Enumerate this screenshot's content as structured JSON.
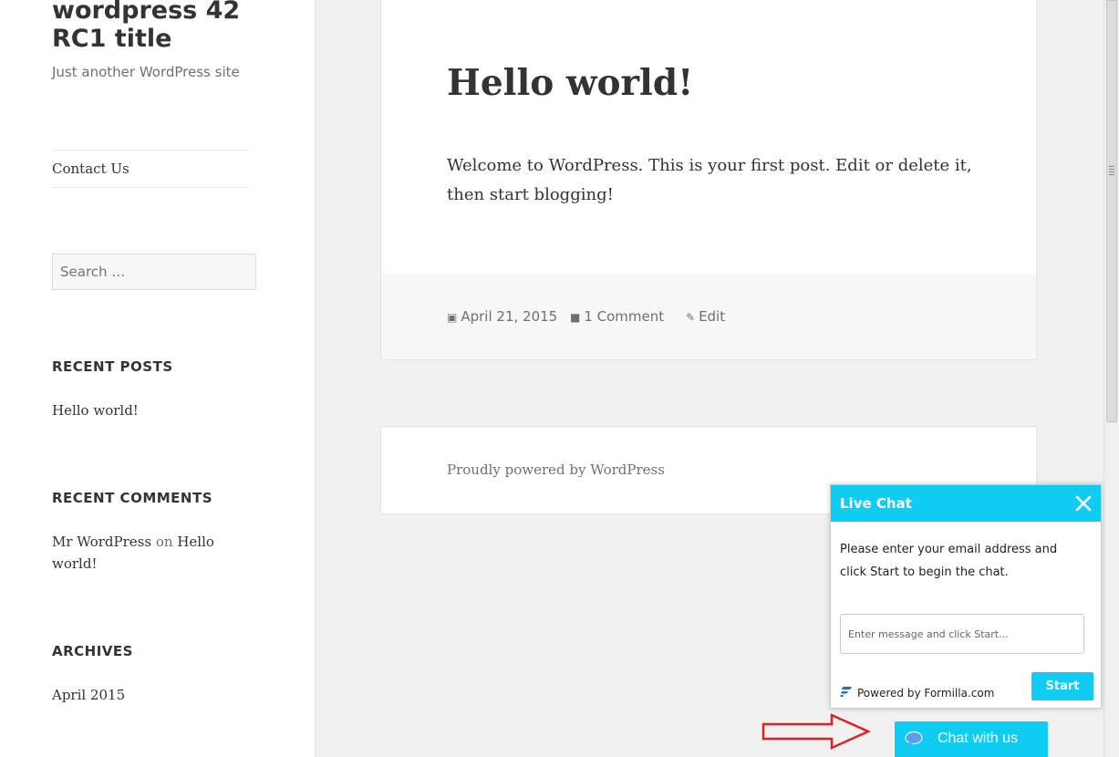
{
  "site": {
    "title": "wordpress 42 RC1 title",
    "description": "Just another WordPress site"
  },
  "menu": {
    "items": [
      {
        "label": "Contact Us"
      }
    ]
  },
  "search": {
    "placeholder": "Search …"
  },
  "widgets": {
    "recent_posts": {
      "title": "RECENT POSTS",
      "items": [
        "Hello world!"
      ]
    },
    "recent_comments": {
      "title": "RECENT COMMENTS",
      "author": "Mr WordPress",
      "connector": "on",
      "post": "Hello world!"
    },
    "archives": {
      "title": "ARCHIVES",
      "items": [
        "April 2015"
      ]
    }
  },
  "post": {
    "title": "Hello world!",
    "body": "Welcome to WordPress. This is your first post. Edit or delete it, then start blogging!",
    "date": "April 21, 2015",
    "comments": "1 Comment",
    "edit": "Edit"
  },
  "footer": {
    "text": "Proudly powered by WordPress"
  },
  "live_chat": {
    "title": "Live Chat",
    "message": "Please enter your email address and click Start to begin the chat.",
    "input_placeholder": "Enter message and click Start...",
    "powered_by": "Powered by Formilla.com",
    "start_label": "Start",
    "tab_label": "Chat with us"
  },
  "colors": {
    "accent": "#0fcdf2",
    "arrow": "#e02020"
  },
  "icons": {
    "date": "calendar-icon",
    "comments": "comment-icon",
    "edit": "pencil-icon",
    "close": "close-icon",
    "chat_bubble": "chat-bubble-icon",
    "formilla_logo": "formilla-logo-icon",
    "annotation": "red-arrow-annotation"
  }
}
